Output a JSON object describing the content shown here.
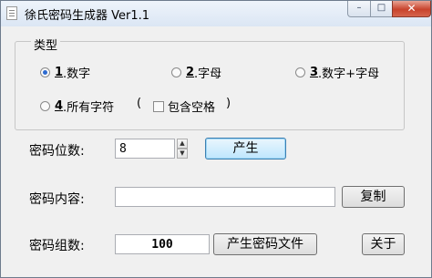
{
  "window": {
    "title": "徐氏密码生成器 Ver1.1",
    "minimize_glyph": "–",
    "maximize_glyph": "□",
    "close_glyph": "✕"
  },
  "type_group": {
    "legend": "类型",
    "options": [
      {
        "num": "1",
        "text": ".数字",
        "selected": true
      },
      {
        "num": "2",
        "text": ".字母",
        "selected": false
      },
      {
        "num": "3",
        "text": ".数字+字母",
        "selected": false
      },
      {
        "num": "4",
        "text": ".所有字符",
        "selected": false
      }
    ],
    "paren_open": "(",
    "paren_close": ")",
    "include_space_label": "包含空格",
    "include_space_checked": false
  },
  "length": {
    "label": "密码位数:",
    "value": "8",
    "generate_button": "产生"
  },
  "content": {
    "label": "密码内容:",
    "value": "",
    "copy_button": "复制"
  },
  "count": {
    "label": "密码组数:",
    "value": "100",
    "file_button": "产生密码文件",
    "about_button": "关于"
  }
}
